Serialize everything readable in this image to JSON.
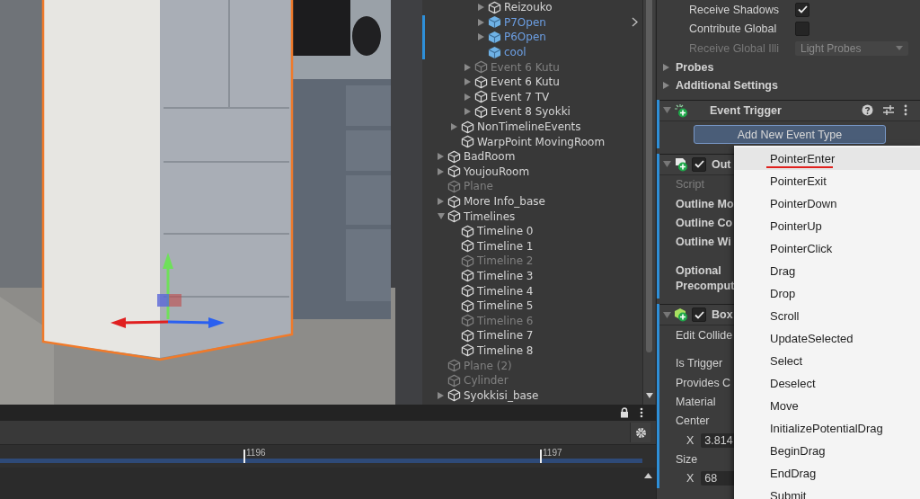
{
  "hierarchy": {
    "items": [
      {
        "children": [
          {
            "children": [
              {
                "children": [
                  {
                    "name": "Reizouko",
                    "kind": "object",
                    "expandable": true,
                    "expanded": false,
                    "active": true,
                    "hovered": false
                  },
                  {
                    "name": "P7Open",
                    "kind": "prefab",
                    "expandable": true,
                    "expanded": false,
                    "active": true,
                    "hovered": true
                  },
                  {
                    "name": "P6Open",
                    "kind": "prefab",
                    "expandable": true,
                    "expanded": false,
                    "active": true,
                    "hovered": false
                  },
                  {
                    "name": "cool",
                    "kind": "prefab",
                    "expandable": false,
                    "expanded": false,
                    "active": true,
                    "hovered": false
                  }
                ]
              },
              {
                "name": "Event 6 Kutu",
                "kind": "object",
                "expandable": true,
                "expanded": false,
                "active": false,
                "hovered": false
              },
              {
                "name": "Event 6 Kutu",
                "kind": "object",
                "expandable": true,
                "expanded": false,
                "active": true,
                "hovered": false
              },
              {
                "name": "Event 7 TV",
                "kind": "object",
                "expandable": true,
                "expanded": false,
                "active": true,
                "hovered": false
              },
              {
                "name": "Event 8 Syokki",
                "kind": "object",
                "expandable": true,
                "expanded": false,
                "active": true,
                "hovered": false
              }
            ]
          },
          {
            "name": "NonTimelineEvents",
            "kind": "object",
            "expandable": true,
            "expanded": false,
            "active": true,
            "hovered": false
          },
          {
            "name": "WarpPoint MovingRoom",
            "kind": "object",
            "expandable": false,
            "expanded": false,
            "active": true,
            "hovered": false
          }
        ]
      },
      {
        "name": "BadRoom",
        "kind": "object",
        "expandable": true,
        "expanded": false,
        "active": true,
        "hovered": false
      },
      {
        "name": "YoujouRoom",
        "kind": "object",
        "expandable": true,
        "expanded": false,
        "active": true,
        "hovered": false
      },
      {
        "name": "Plane",
        "kind": "object",
        "expandable": false,
        "expanded": false,
        "active": false,
        "hovered": false
      },
      {
        "name": "More Info_base",
        "kind": "object",
        "expandable": true,
        "expanded": false,
        "active": true,
        "hovered": false
      },
      {
        "name": "Timelines",
        "kind": "object",
        "expandable": true,
        "expanded": true,
        "active": true,
        "hovered": false,
        "children": [
          {
            "name": "Timeline 0",
            "kind": "object",
            "expandable": false,
            "expanded": false,
            "active": true,
            "hovered": false
          },
          {
            "name": "Timeline 1",
            "kind": "object",
            "expandable": false,
            "expanded": false,
            "active": true,
            "hovered": false
          },
          {
            "name": "Timeline 2",
            "kind": "object",
            "expandable": false,
            "expanded": false,
            "active": false,
            "hovered": false
          },
          {
            "name": "Timeline 3",
            "kind": "object",
            "expandable": false,
            "expanded": false,
            "active": true,
            "hovered": false
          },
          {
            "name": "Timeline 4",
            "kind": "object",
            "expandable": false,
            "expanded": false,
            "active": true,
            "hovered": false
          },
          {
            "name": "Timeline 5",
            "kind": "object",
            "expandable": false,
            "expanded": false,
            "active": true,
            "hovered": false
          },
          {
            "name": "Timeline 6",
            "kind": "object",
            "expandable": false,
            "expanded": false,
            "active": false,
            "hovered": false
          },
          {
            "name": "Timeline 7",
            "kind": "object",
            "expandable": false,
            "expanded": false,
            "active": true,
            "hovered": false
          },
          {
            "name": "Timeline 8",
            "kind": "object",
            "expandable": false,
            "expanded": false,
            "active": true,
            "hovered": false
          }
        ]
      },
      {
        "name": "Plane (2)",
        "kind": "object",
        "expandable": false,
        "expanded": false,
        "active": false,
        "hovered": false
      },
      {
        "name": "Cylinder",
        "kind": "object",
        "expandable": false,
        "expanded": false,
        "active": false,
        "hovered": false
      },
      {
        "name": "Syokkisi_base",
        "kind": "object",
        "expandable": true,
        "expanded": false,
        "active": true,
        "hovered": false
      }
    ]
  },
  "inspector": {
    "rows": [
      {
        "kind": "toggle",
        "label": "Receive Shadows",
        "checked": true
      },
      {
        "kind": "toggle",
        "label": "Contribute Global",
        "checked": false
      },
      {
        "kind": "dropdown",
        "label": "Receive Global Illi",
        "value": "Light Probes",
        "disabled": true
      },
      {
        "kind": "foldout",
        "label": "Probes",
        "expanded": false
      },
      {
        "kind": "foldout",
        "label": "Additional Settings",
        "expanded": false
      }
    ],
    "components": [
      {
        "title": "Event Trigger",
        "kind": "event_trigger",
        "expanded": true,
        "overridden": true,
        "fields": [
          {
            "kind": "button",
            "label": "Add New Event Type"
          }
        ]
      },
      {
        "title": "Out",
        "kind": "script",
        "enabled": true,
        "expanded": true,
        "overridden": true,
        "fields": [
          {
            "kind": "script_ref",
            "label": "Script"
          },
          {
            "kind": "override",
            "label": "Outline Mo"
          },
          {
            "kind": "override",
            "label": "Outline Co"
          },
          {
            "kind": "override",
            "label": "Outline Wi"
          },
          {
            "kind": "multiline",
            "label": "Optional Precomput"
          }
        ]
      },
      {
        "title": "Box",
        "kind": "box_collider",
        "enabled": true,
        "expanded": true,
        "overridden": true,
        "fields": [
          {
            "kind": "edit",
            "label": "Edit Collide"
          },
          {
            "kind": "label",
            "label": "Is Trigger"
          },
          {
            "kind": "label",
            "label": "Provides C"
          },
          {
            "kind": "label",
            "label": "Material"
          },
          {
            "kind": "label",
            "label": "Center"
          },
          {
            "kind": "vector",
            "label": "X",
            "value": "3.814"
          },
          {
            "kind": "label",
            "label": "Size"
          },
          {
            "kind": "vector",
            "label": "X",
            "value": "68"
          }
        ]
      }
    ]
  },
  "menu": {
    "items": [
      {
        "label": "PointerEnter",
        "selected": true
      },
      {
        "label": "PointerExit",
        "selected": false
      },
      {
        "label": "PointerDown",
        "selected": false
      },
      {
        "label": "PointerUp",
        "selected": false
      },
      {
        "label": "PointerClick",
        "selected": false
      },
      {
        "label": "Drag",
        "selected": false
      },
      {
        "label": "Drop",
        "selected": false
      },
      {
        "label": "Scroll",
        "selected": false
      },
      {
        "label": "UpdateSelected",
        "selected": false
      },
      {
        "label": "Select",
        "selected": false
      },
      {
        "label": "Deselect",
        "selected": false
      },
      {
        "label": "Move",
        "selected": false
      },
      {
        "label": "InitializePotentialDrag",
        "selected": false
      },
      {
        "label": "BeginDrag",
        "selected": false
      },
      {
        "label": "EndDrag",
        "selected": false
      },
      {
        "label": "Submit",
        "selected": false
      }
    ]
  },
  "timeline": {
    "ticks": [
      "1196",
      "1197"
    ]
  }
}
